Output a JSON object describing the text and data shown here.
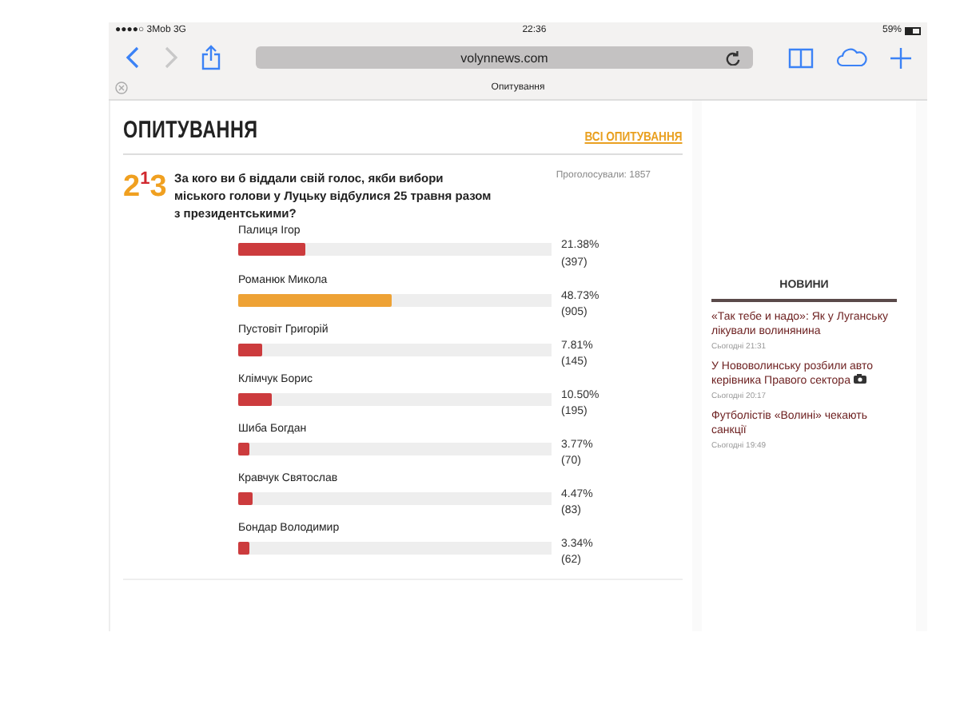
{
  "status_bar": {
    "carrier": "●●●●○ 3Mob  3G",
    "time": "22:36",
    "battery": "59%"
  },
  "browser": {
    "url": "volynnews.com",
    "tab_title": "Опитування"
  },
  "poll": {
    "heading": "ОПИТУВАННЯ",
    "all_link": "ВСІ ОПИТУВАННЯ",
    "logo": "2$^{1}$3",
    "question": "За кого ви б віддали свій голос, якби вибори міського голови у Луцьку відбулися 25 травня разом з президентськими?",
    "votes_total": "Проголосували: 1857",
    "options": [
      {
        "name": "Палиця Ігор",
        "level": 0.2138,
        "percent": "21.38%",
        "count": "(397)",
        "leading": false
      },
      {
        "name": "Романюк Микола",
        "level": 0.4873,
        "percent": "48.73%",
        "count": "(905)",
        "leading": true
      },
      {
        "name": "Пустовіт Григорій",
        "level": 0.0781,
        "percent": "7.81%",
        "count": "(145)",
        "leading": false
      },
      {
        "name": "Клімчук Борис",
        "level": 0.105,
        "percent": "10.50%",
        "count": "(195)",
        "leading": false
      },
      {
        "name": "Шиба Богдан",
        "level": 0.0377,
        "percent": "3.77%",
        "count": "(70)",
        "leading": false
      },
      {
        "name": "Кравчук Святослав",
        "level": 0.0447,
        "percent": "4.47%",
        "count": "(83)",
        "leading": false
      },
      {
        "name": "Бондар Володимир",
        "level": 0.0334,
        "percent": "3.34%",
        "count": "(62)",
        "leading": false
      }
    ]
  },
  "news": {
    "heading": "НОВИНИ",
    "items": [
      {
        "title": "«Так тебе и надо»: Як у Луганську лікували волинянина",
        "time": "Сьогодні 21:31",
        "photo": false
      },
      {
        "title": "У Нововолинську розбили авто керівника Правого сектора",
        "time": "Сьогодні 20:17",
        "photo": true
      },
      {
        "title": "Футболістів «Волині» чекають санкції",
        "time": "Сьогодні 19:49",
        "photo": false
      }
    ]
  }
}
